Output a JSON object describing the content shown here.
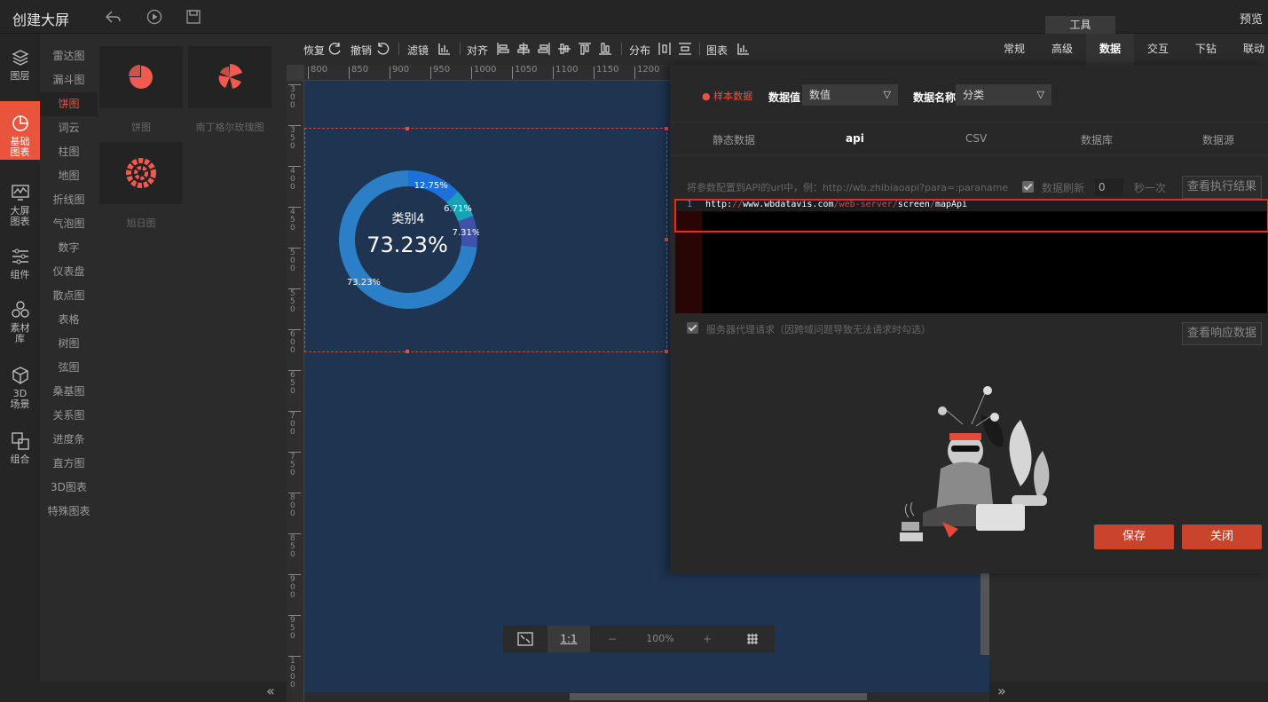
{
  "app": {
    "title": "创建大屏",
    "preview": "预览",
    "tools_tab": "工具"
  },
  "leftbar": [
    {
      "label": "图层",
      "icon": "layers-icon"
    },
    {
      "label": "基础\n图表",
      "icon": "pie-chart-icon",
      "active": true
    },
    {
      "label": "大屏\n图表",
      "icon": "monitor-chart-icon"
    },
    {
      "label": "组件",
      "icon": "sliders-icon"
    },
    {
      "label": "素材\n库",
      "icon": "shapes-icon"
    },
    {
      "label": "3D\n场景",
      "icon": "cube-icon"
    },
    {
      "label": "组合",
      "icon": "group-icon"
    }
  ],
  "categories": [
    "雷达图",
    "漏斗图",
    "饼图",
    "词云",
    "柱图",
    "地图",
    "折线图",
    "气泡图",
    "数字",
    "仪表盘",
    "散点图",
    "表格",
    "树图",
    "弦图",
    "桑基图",
    "关系图",
    "进度条",
    "直方图",
    "3D图表",
    "特殊图表"
  ],
  "active_category": "饼图",
  "thumbnails": [
    {
      "label": "饼图"
    },
    {
      "label": "南丁格尔玫瑰图"
    },
    {
      "label": "旭日图"
    }
  ],
  "toolbar": {
    "restore": "恢复",
    "undo": "撤销",
    "filter": "滤镜",
    "align": "对齐",
    "distribute": "分布",
    "chart": "图表",
    "right_tabs": [
      "常规",
      "高级",
      "数据",
      "交互",
      "下钻",
      "联动"
    ],
    "active_right_tab": "数据"
  },
  "ruler": {
    "top_marks": [
      "800",
      "850",
      "900",
      "950",
      "1000",
      "1050",
      "1100",
      "1150",
      "1200"
    ],
    "left_marks": [
      "300",
      "350",
      "400",
      "450",
      "500",
      "550",
      "600",
      "650",
      "700",
      "750",
      "800",
      "850",
      "900",
      "950",
      "1000"
    ]
  },
  "donut": {
    "center_label": "类别4",
    "center_value": "73.23%",
    "slices": [
      {
        "label": "12.75%",
        "value": 12.75,
        "color": "#1e6fd9"
      },
      {
        "label": "6.71%",
        "value": 6.71,
        "color": "#17a2b8"
      },
      {
        "label": "7.31%",
        "value": 7.31,
        "color": "#3f51a8"
      },
      {
        "label": "73.23%",
        "value": 73.23,
        "color": "#2a7fc6"
      }
    ]
  },
  "zoom": {
    "fit": "fit-icon",
    "one_to_one": "1:1",
    "minus": "−",
    "value": "100%",
    "plus": "+",
    "grid": "grid-icon"
  },
  "panel": {
    "sample_data": "样本数据",
    "value_label": "数据值",
    "value_select": "数值",
    "name_label": "数据名称",
    "name_select": "分类",
    "source_tabs": [
      "静态数据",
      "api",
      "CSV",
      "数据库",
      "数据源"
    ],
    "active_source_tab": "api",
    "hint": "将参数配置到API的url中，例：http://wb.zhibiaoapi?para=:paraname",
    "refresh_label": "数据刷新",
    "refresh_value": "0",
    "refresh_unit": "秒一次",
    "view_result": "查看执行结果",
    "editor_line_number": "1",
    "api_url_parts": [
      "http:",
      "//",
      "www.wbdatavis.com",
      "/",
      "web-server",
      "/",
      "screen",
      "/",
      "mapApi"
    ],
    "proxy_label": "服务器代理请求（因跨域问题导致无法请求时勾选）",
    "view_response": "查看响应数据",
    "save": "保存",
    "close": "关闭"
  }
}
